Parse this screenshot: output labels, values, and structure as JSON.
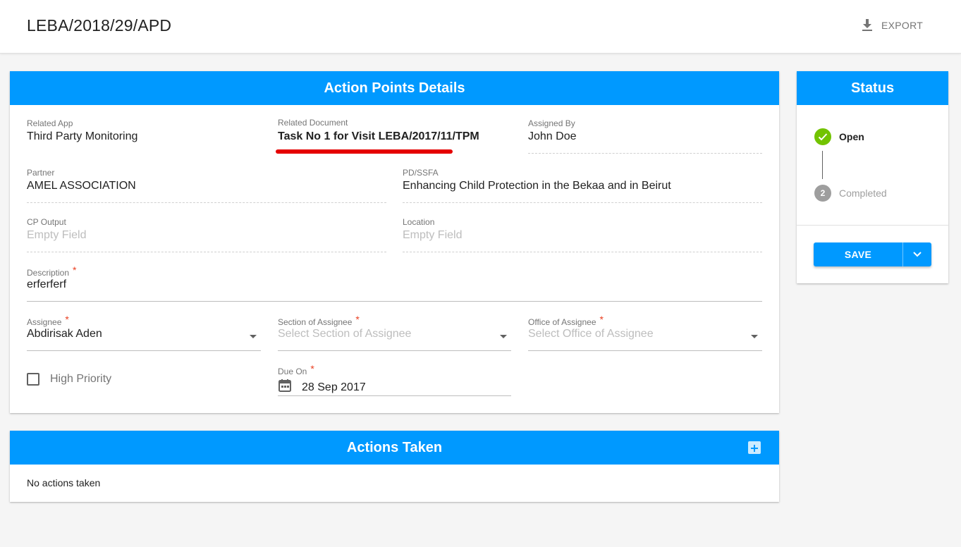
{
  "header": {
    "title": "LEBA/2018/29/APD",
    "export_label": "EXPORT"
  },
  "details": {
    "title": "Action Points Details",
    "related_app": {
      "label": "Related App",
      "value": "Third Party Monitoring"
    },
    "related_document": {
      "label": "Related Document",
      "value": "Task No 1 for Visit LEBA/2017/11/TPM"
    },
    "assigned_by": {
      "label": "Assigned By",
      "value": "John Doe"
    },
    "partner": {
      "label": "Partner",
      "value": "AMEL ASSOCIATION"
    },
    "pd_ssfa": {
      "label": "PD/SSFA",
      "value": "Enhancing Child Protection in the Bekaa and in Beirut"
    },
    "cp_output": {
      "label": "CP Output",
      "value": "Empty Field"
    },
    "location": {
      "label": "Location",
      "value": "Empty Field"
    },
    "description": {
      "label": "Description",
      "required_mark": "*",
      "value": "erferferf"
    },
    "assignee": {
      "label": "Assignee",
      "required_mark": "*",
      "value": "Abdirisak Aden"
    },
    "section_of_assignee": {
      "label": "Section of Assignee",
      "required_mark": "*",
      "placeholder": "Select Section of Assignee"
    },
    "office_of_assignee": {
      "label": "Office of Assignee",
      "required_mark": "*",
      "placeholder": "Select Office of Assignee"
    },
    "high_priority": {
      "label": "High Priority",
      "checked": false
    },
    "due_on": {
      "label": "Due On",
      "required_mark": "*",
      "value": "28 Sep 2017"
    }
  },
  "status": {
    "title": "Status",
    "steps": [
      {
        "number": "1",
        "label": "Open",
        "state": "done"
      },
      {
        "number": "2",
        "label": "Completed",
        "state": "pending"
      }
    ],
    "save_label": "SAVE"
  },
  "actions_taken": {
    "title": "Actions Taken",
    "empty_text": "No actions taken"
  },
  "colors": {
    "primary": "#0099ff",
    "success": "#72c300",
    "required": "#ea4022",
    "highlight": "#e50000"
  },
  "icons": {
    "export": "download-icon",
    "calendar": "calendar-icon",
    "check": "check-icon",
    "dropdown": "chevron-down-icon",
    "add": "plus-box-icon"
  }
}
